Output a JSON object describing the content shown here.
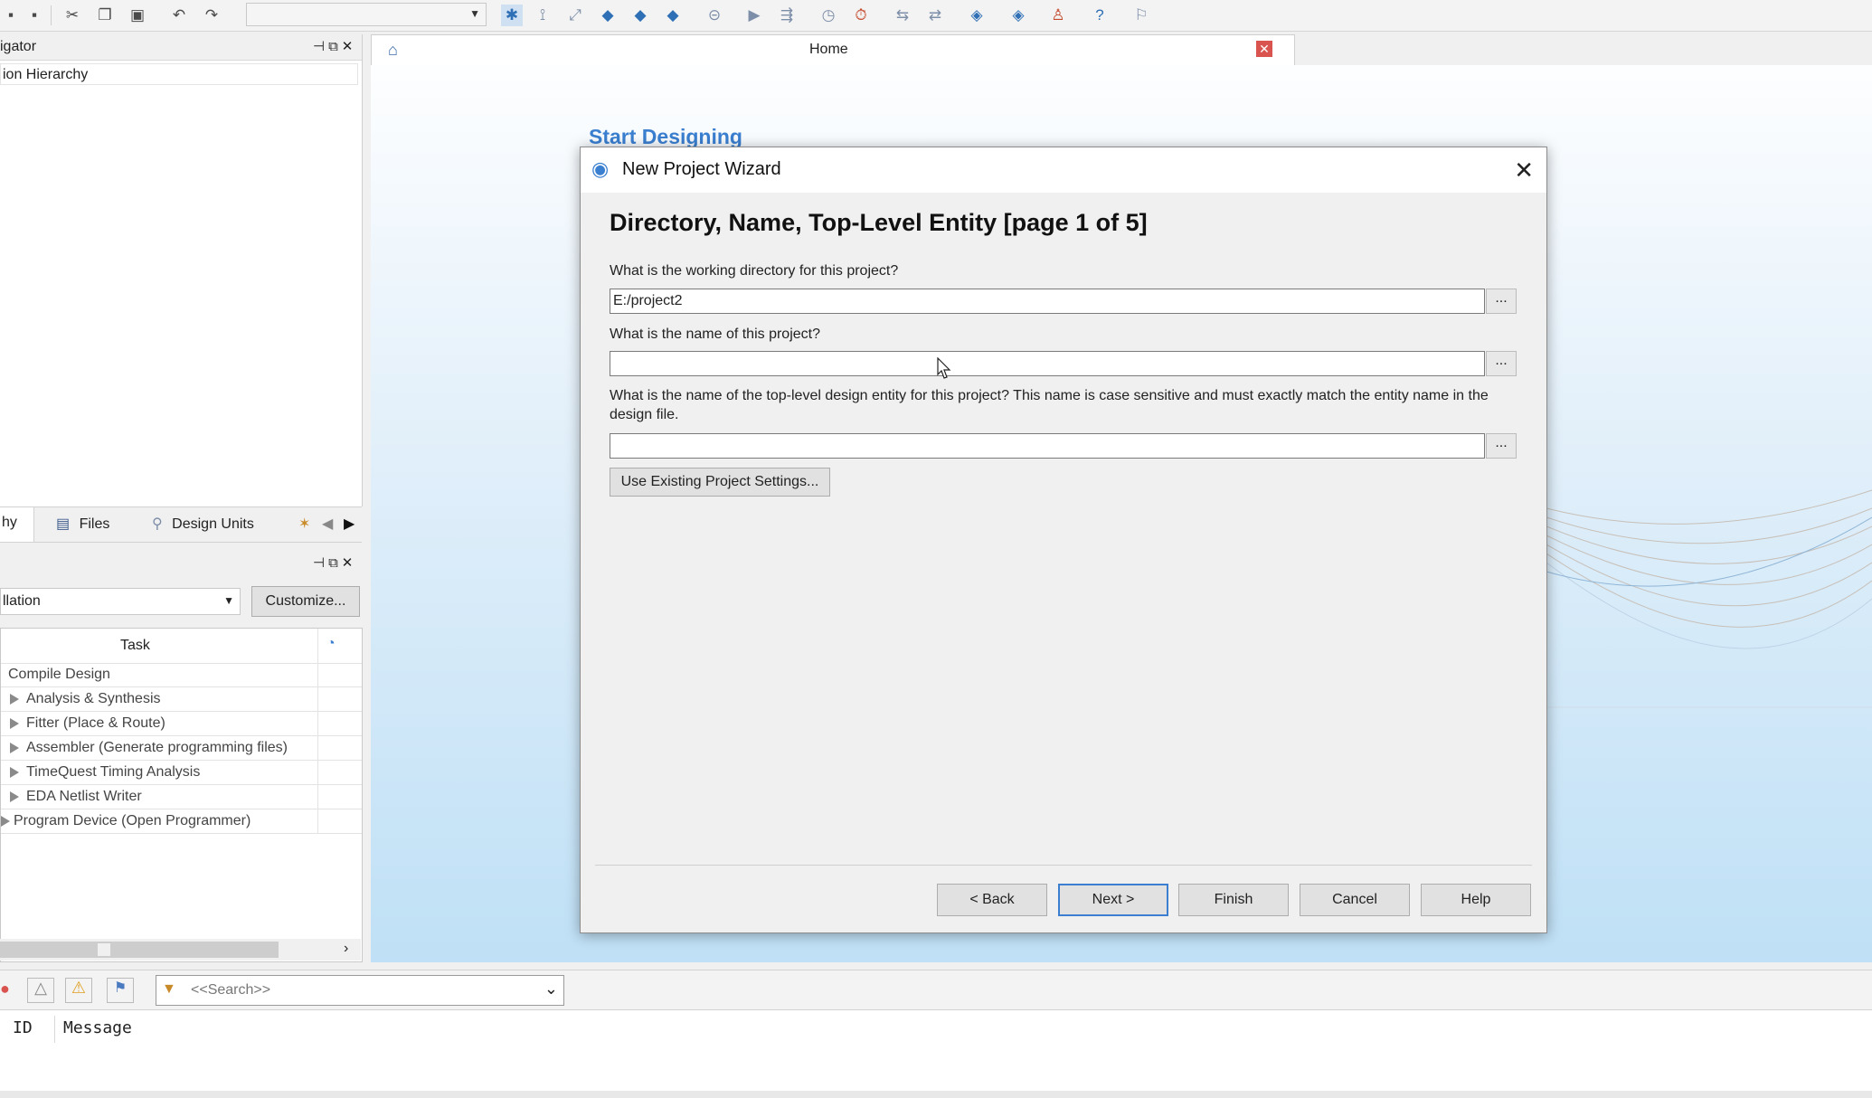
{
  "toolbar": {
    "combo_value": ""
  },
  "project_navigator": {
    "title": "igator",
    "hierarchy_row": "ion Hierarchy",
    "tabs": [
      {
        "label": "hy"
      },
      {
        "label": "Files"
      },
      {
        "label": "Design Units"
      }
    ]
  },
  "tasks": {
    "flow_value": "llation",
    "customize_label": "Customize...",
    "column_task": "Task",
    "rows": [
      {
        "label": "Compile Design"
      },
      {
        "label": "Analysis & Synthesis"
      },
      {
        "label": "Fitter (Place & Route)"
      },
      {
        "label": "Assembler (Generate programming files)"
      },
      {
        "label": "TimeQuest Timing Analysis"
      },
      {
        "label": "EDA Netlist Writer"
      },
      {
        "label": "Program Device (Open Programmer)"
      }
    ]
  },
  "home": {
    "tab_label": "Home",
    "start_designing": "Start Designing"
  },
  "messages": {
    "search_placeholder": "<<Search>>",
    "col_id": "ID",
    "col_message": "Message"
  },
  "dialog": {
    "title": "New Project Wizard",
    "heading": "Directory, Name, Top-Level Entity [page 1 of 5]",
    "q_directory": "What is the working directory for this project?",
    "directory_value": "E:/project2",
    "q_name": "What is the name of this project?",
    "name_value": "",
    "q_top": "What is the name of the top-level design entity for this project? This name is case sensitive and must exactly match the entity name in the design file.",
    "top_value": "",
    "browse_label": "...",
    "use_existing_label": "Use Existing Project Settings...",
    "buttons": {
      "back": "< Back",
      "next": "Next >",
      "finish": "Finish",
      "cancel": "Cancel",
      "help": "Help"
    }
  }
}
